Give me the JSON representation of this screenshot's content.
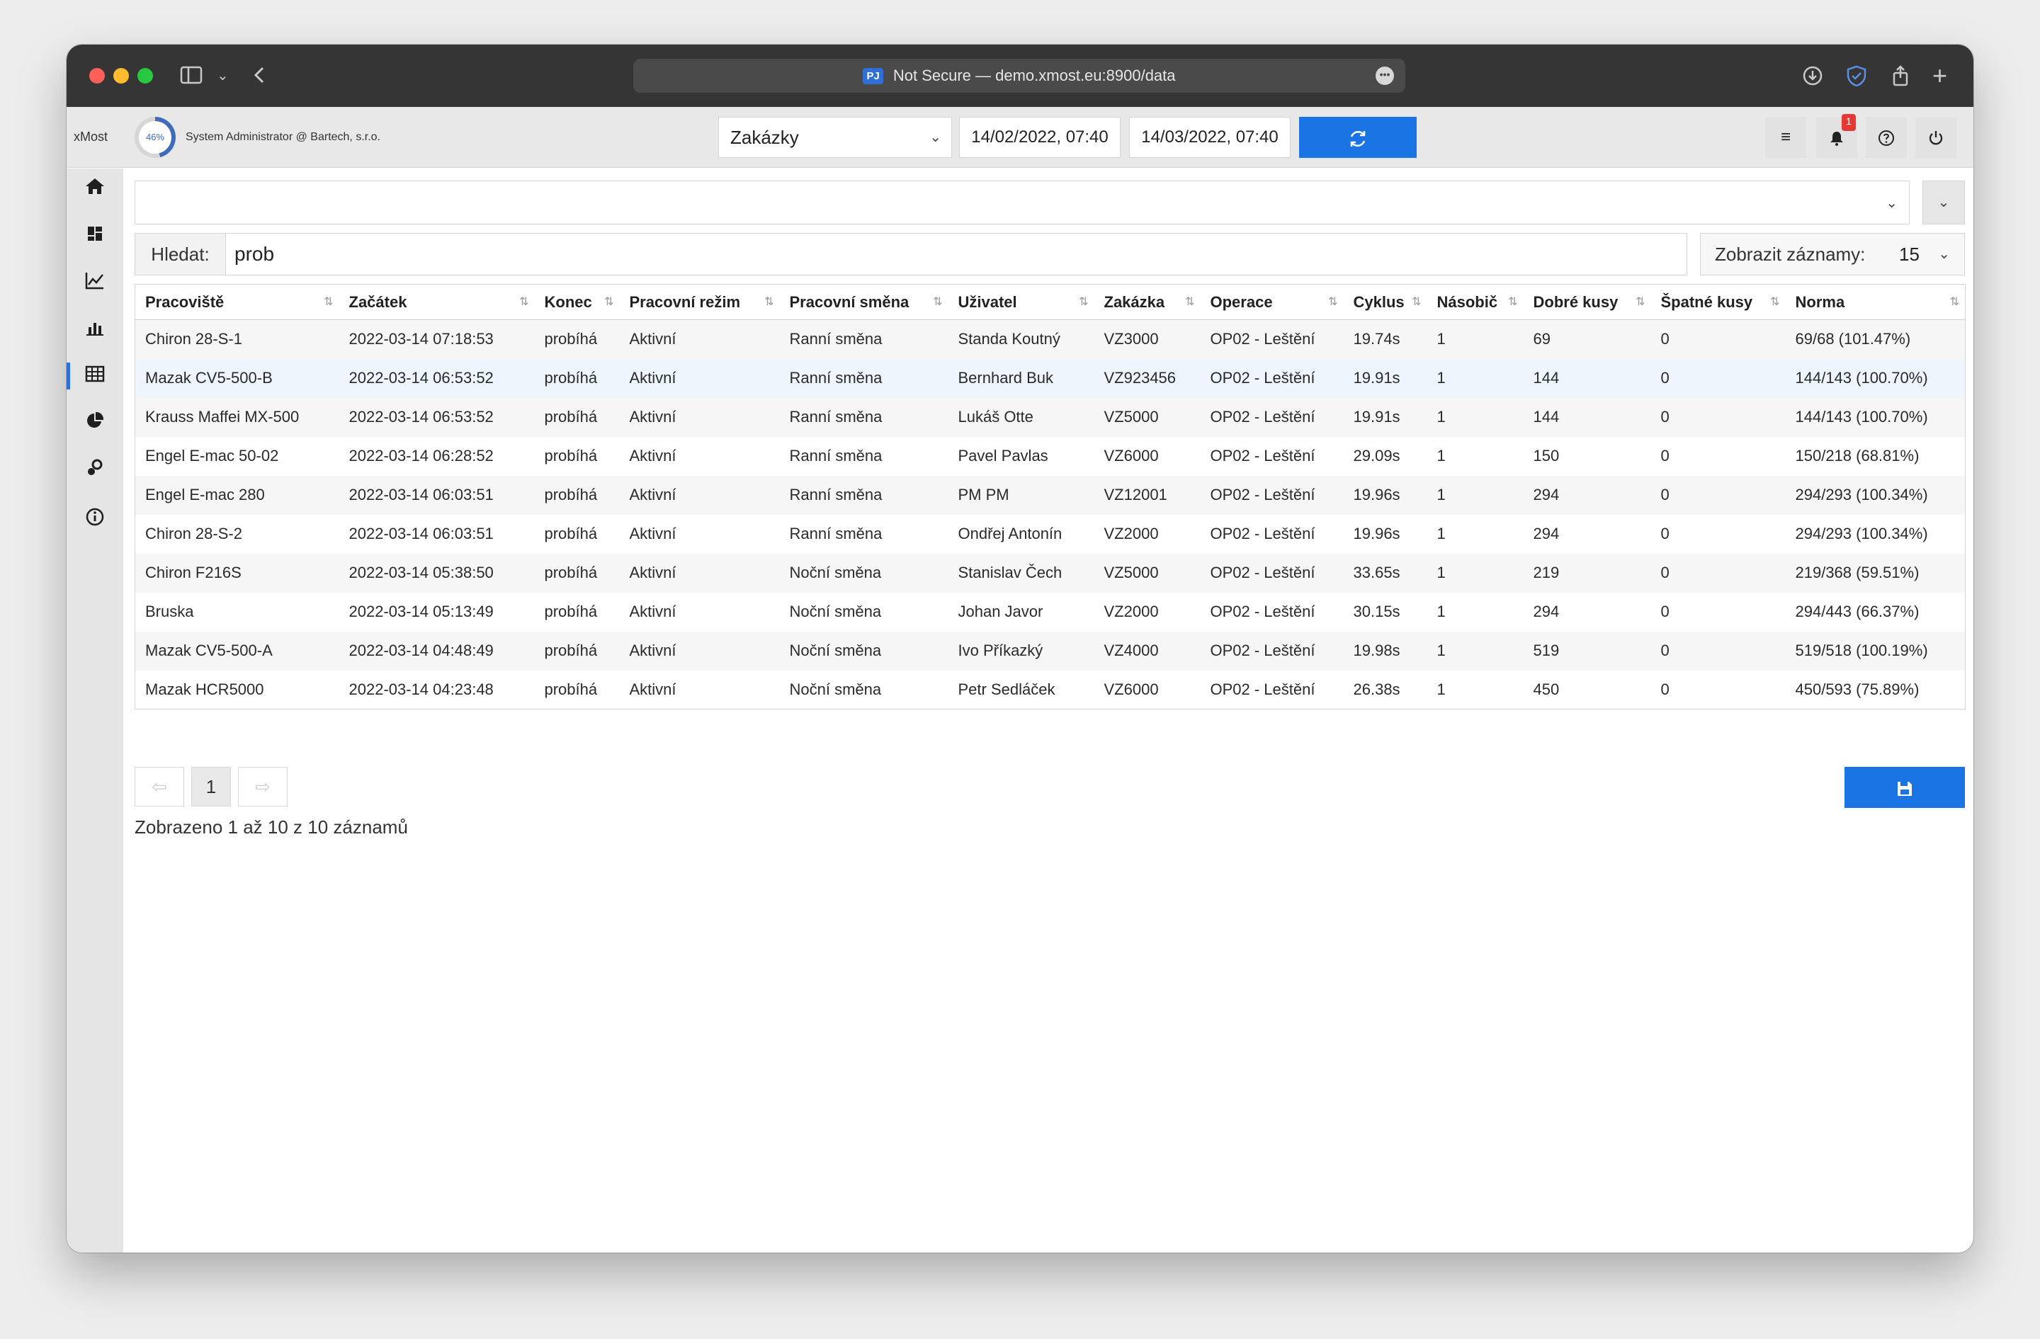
{
  "browser": {
    "badge": "PJ",
    "url_text": "Not Secure — demo.xmost.eu:8900/data"
  },
  "header": {
    "brand": "xMost",
    "gauge_value": "46%",
    "user": "System Administrator @ Bartech, s.r.o.",
    "view_select": "Zakázky",
    "date_from": "14/02/2022, 07:40",
    "date_to": "14/03/2022, 07:40",
    "notification_count": "1"
  },
  "search": {
    "label": "Hledat:",
    "value": "prob"
  },
  "page_size": {
    "label": "Zobrazit záznamy:",
    "value": "15"
  },
  "table": {
    "columns": [
      "Pracoviště",
      "Začátek",
      "Konec",
      "Pracovní režim",
      "Pracovní směna",
      "Uživatel",
      "Zakázka",
      "Operace",
      "Cyklus",
      "Násobič",
      "Dobré kusy",
      "Špatné kusy",
      "Norma"
    ],
    "rows": [
      [
        "Chiron 28-S-1",
        "2022-03-14 07:18:53",
        "probíhá",
        "Aktivní",
        "Ranní směna",
        "Standa Koutný",
        "VZ3000",
        "OP02 - Leštění",
        "19.74s",
        "1",
        "69",
        "0",
        "69/68 (101.47%)"
      ],
      [
        "Mazak CV5-500-B",
        "2022-03-14 06:53:52",
        "probíhá",
        "Aktivní",
        "Ranní směna",
        "Bernhard Buk",
        "VZ923456",
        "OP02 - Leštění",
        "19.91s",
        "1",
        "144",
        "0",
        "144/143 (100.70%)"
      ],
      [
        "Krauss Maffei MX-500",
        "2022-03-14 06:53:52",
        "probíhá",
        "Aktivní",
        "Ranní směna",
        "Lukáš Otte",
        "VZ5000",
        "OP02 - Leštění",
        "19.91s",
        "1",
        "144",
        "0",
        "144/143 (100.70%)"
      ],
      [
        "Engel E-mac 50-02",
        "2022-03-14 06:28:52",
        "probíhá",
        "Aktivní",
        "Ranní směna",
        "Pavel Pavlas",
        "VZ6000",
        "OP02 - Leštění",
        "29.09s",
        "1",
        "150",
        "0",
        "150/218 (68.81%)"
      ],
      [
        "Engel E-mac 280",
        "2022-03-14 06:03:51",
        "probíhá",
        "Aktivní",
        "Ranní směna",
        "PM PM",
        "VZ12001",
        "OP02 - Leštění",
        "19.96s",
        "1",
        "294",
        "0",
        "294/293 (100.34%)"
      ],
      [
        "Chiron 28-S-2",
        "2022-03-14 06:03:51",
        "probíhá",
        "Aktivní",
        "Ranní směna",
        "Ondřej Antonín",
        "VZ2000",
        "OP02 - Leštění",
        "19.96s",
        "1",
        "294",
        "0",
        "294/293 (100.34%)"
      ],
      [
        "Chiron F216S",
        "2022-03-14 05:38:50",
        "probíhá",
        "Aktivní",
        "Noční směna",
        "Stanislav Čech",
        "VZ5000",
        "OP02 - Leštění",
        "33.65s",
        "1",
        "219",
        "0",
        "219/368 (59.51%)"
      ],
      [
        "Bruska",
        "2022-03-14 05:13:49",
        "probíhá",
        "Aktivní",
        "Noční směna",
        "Johan Javor",
        "VZ2000",
        "OP02 - Leštění",
        "30.15s",
        "1",
        "294",
        "0",
        "294/443 (66.37%)"
      ],
      [
        "Mazak CV5-500-A",
        "2022-03-14 04:48:49",
        "probíhá",
        "Aktivní",
        "Noční směna",
        "Ivo Příkazký",
        "VZ4000",
        "OP02 - Leštění",
        "19.98s",
        "1",
        "519",
        "0",
        "519/518 (100.19%)"
      ],
      [
        "Mazak HCR5000",
        "2022-03-14 04:23:48",
        "probíhá",
        "Aktivní",
        "Noční směna",
        "Petr Sedláček",
        "VZ6000",
        "OP02 - Leštění",
        "26.38s",
        "1",
        "450",
        "0",
        "450/593 (75.89%)"
      ]
    ]
  },
  "pagination": {
    "prev": "⇦",
    "current": "1",
    "next": "⇨",
    "summary": "Zobrazeno 1 až 10 z 10 záznamů"
  },
  "colors": {
    "accent": "#1b74e4",
    "gauge": "#3f6bb8",
    "badge": "#e53935"
  }
}
